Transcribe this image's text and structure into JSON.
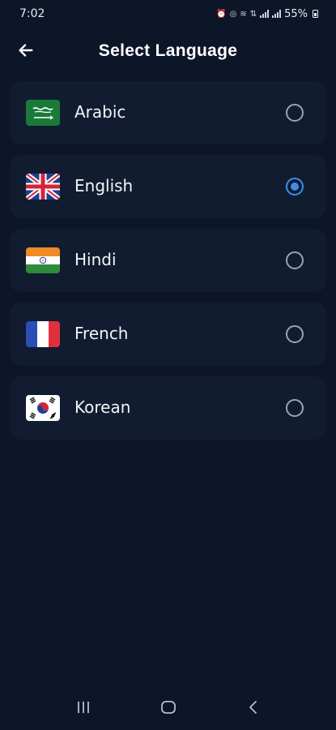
{
  "status_bar": {
    "time": "7:02",
    "battery": "55%"
  },
  "header": {
    "title": "Select Language"
  },
  "languages": [
    {
      "label": "Arabic",
      "flag": "saudi-arabia-flag",
      "selected": false
    },
    {
      "label": "English",
      "flag": "uk-flag",
      "selected": true
    },
    {
      "label": "Hindi",
      "flag": "india-flag",
      "selected": false
    },
    {
      "label": "French",
      "flag": "france-flag",
      "selected": false
    },
    {
      "label": "Korean",
      "flag": "south-korea-flag",
      "selected": false
    }
  ],
  "colors": {
    "background": "#0d1629",
    "card": "#111c31",
    "accent": "#3b8fe8"
  }
}
